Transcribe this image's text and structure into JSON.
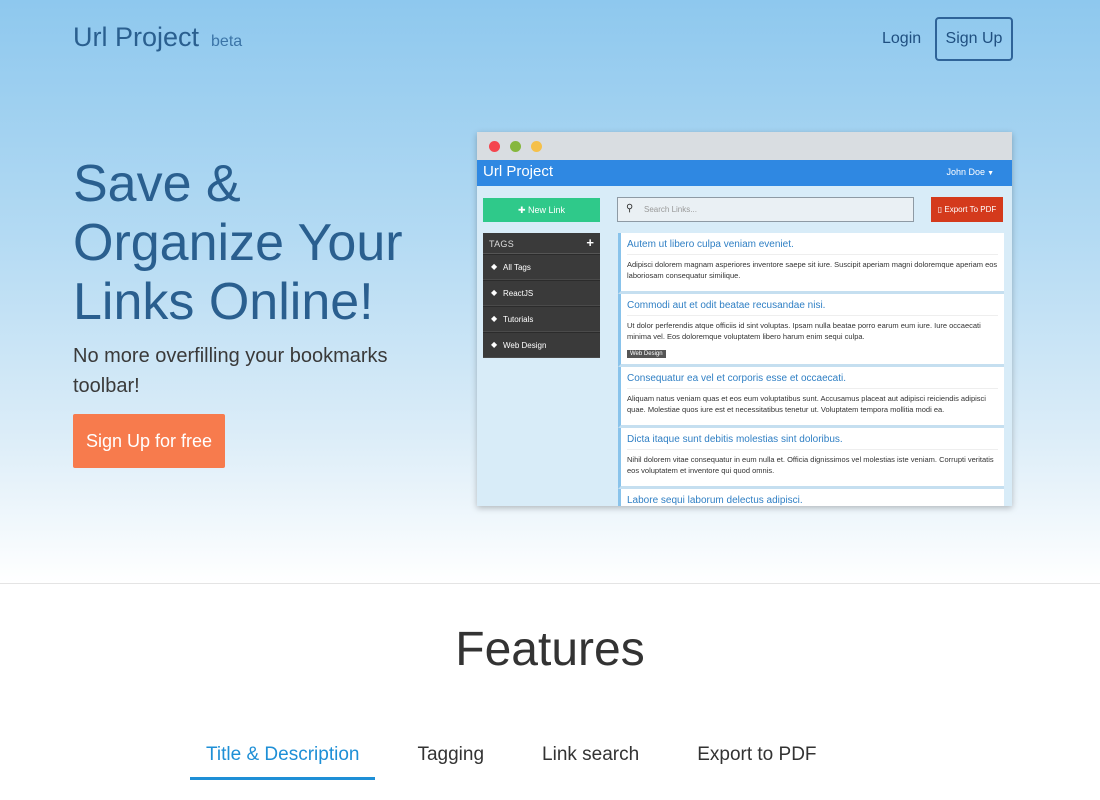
{
  "header": {
    "brand": "Url Project",
    "beta": "beta",
    "login": "Login",
    "signup": "Sign Up"
  },
  "hero": {
    "title": "Save & Organize Your Links Online!",
    "subtitle": "No more overfilling your bookmarks toolbar!",
    "cta": "Sign Up for free"
  },
  "mockup": {
    "brand": "Url Project",
    "user": "John Doe",
    "new_link": "New Link",
    "search_placeholder": "Search Links...",
    "export": "Export To PDF",
    "tags_header": "TAGS",
    "tags": [
      "All Tags",
      "ReactJS",
      "Tutorials",
      "Web Design"
    ],
    "links": [
      {
        "title": "Autem ut libero culpa veniam eveniet.",
        "description": "Adipisci dolorem magnam asperiores inventore saepe sit iure. Suscipit aperiam magni doloremque aperiam eos laboriosam consequatur similique."
      },
      {
        "title": "Commodi aut et odit beatae recusandae nisi.",
        "description": "Ut dolor perferendis atque officiis id sint voluptas. Ipsam nulla beatae porro earum eum iure. Iure occaecati minima vel. Eos doloremque voluptatem libero harum enim sequi culpa.",
        "tag": "Web Design"
      },
      {
        "title": "Consequatur ea vel et corporis esse et occaecati.",
        "description": "Aliquam natus veniam quas et eos eum voluptatibus sunt. Accusamus placeat aut adipisci reiciendis adipisci quae. Molestiae quos iure est et necessitatibus tenetur ut. Voluptatem tempora mollitia modi ea."
      },
      {
        "title": "Dicta itaque sunt debitis molestias sint doloribus.",
        "description": "Nihil dolorem vitae consequatur in eum nulla et. Officia dignissimos vel molestias iste veniam. Corrupti veritatis eos voluptatem et inventore qui quod omnis."
      },
      {
        "title": "Labore sequi laborum delectus adipisci."
      }
    ]
  },
  "features": {
    "title": "Features",
    "tabs": [
      "Title & Description",
      "Tagging",
      "Link search",
      "Export to PDF"
    ],
    "active_tab": "Title & Description"
  },
  "colors": {
    "primary": "#2a5f8f",
    "cta": "#f77b4d",
    "tab_active": "#1e8fd6",
    "mock_nav": "#2f88e2",
    "new_link": "#2fc98a",
    "export": "#d43a1c"
  },
  "icons": {
    "mock_search": "search-icon",
    "new_link": "plus-icon",
    "export": "pdf-file-icon",
    "tag": "tag-icon"
  }
}
